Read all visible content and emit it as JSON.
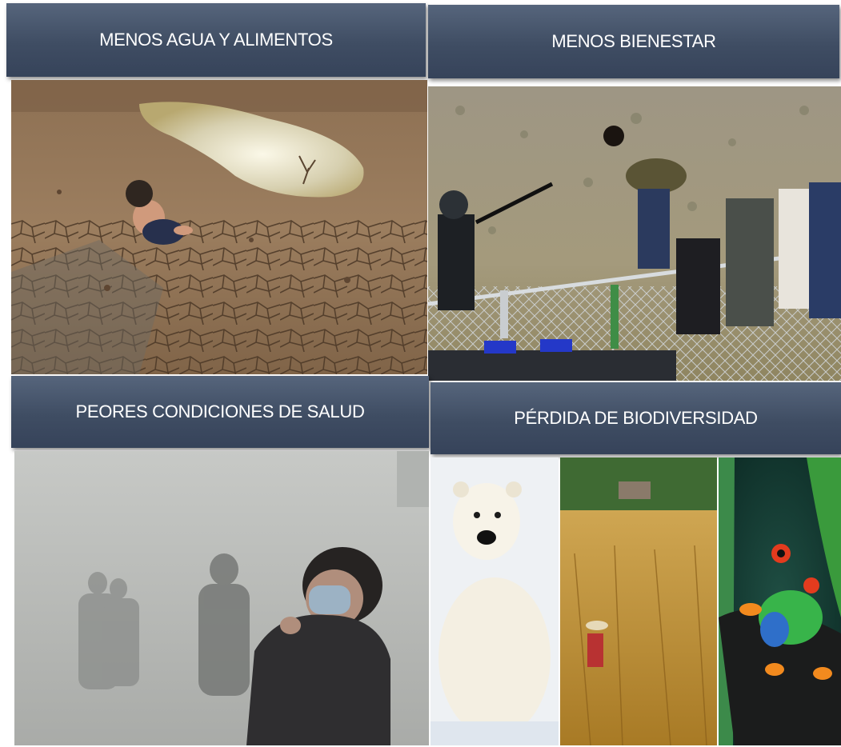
{
  "panels": [
    {
      "title": "MENOS AGUA Y ALIMENTOS",
      "image": "dry-cracked-lakebed-with-child"
    },
    {
      "title": "MENOS BIENESTAR",
      "image": "migrants-climbing-border-fence"
    },
    {
      "title": "PEORES CONDICIONES DE SALUD",
      "image": "people-in-smog-with-face-mask"
    },
    {
      "title": "PÉRDIDA DE BIODIVERSIDAD",
      "image": "polar-bear-wheat-field-tree-frog"
    }
  ]
}
